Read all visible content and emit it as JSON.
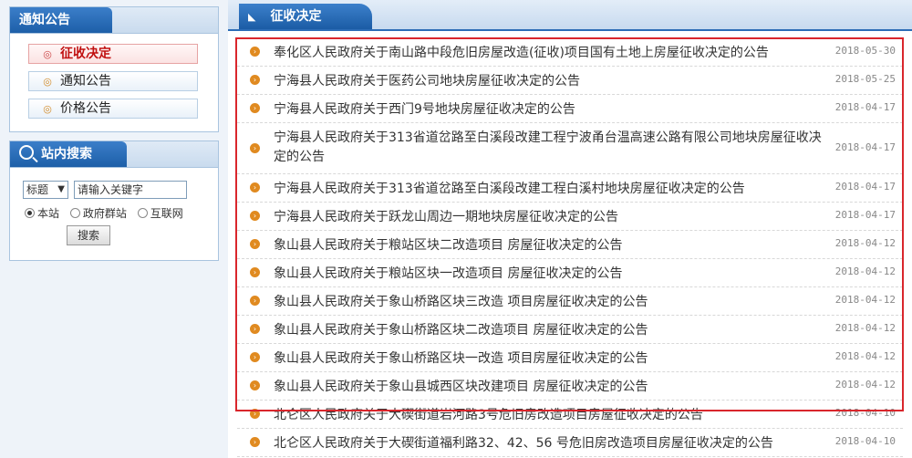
{
  "sidebar": {
    "notice_box": {
      "title": "通知公告",
      "items": [
        {
          "label": "征收决定",
          "active": true
        },
        {
          "label": "通知公告",
          "active": false
        },
        {
          "label": "价格公告",
          "active": false
        }
      ]
    },
    "search_box": {
      "title": "站内搜索",
      "field_select": "标题",
      "keyword_placeholder": "请输入关键字",
      "scopes": [
        {
          "label": "本站",
          "selected": true
        },
        {
          "label": "政府群站",
          "selected": false
        },
        {
          "label": "互联网",
          "selected": false
        }
      ],
      "search_button": "搜索"
    }
  },
  "main": {
    "section_title": "征收决定",
    "items": [
      {
        "title": "奉化区人民政府关于南山路中段危旧房屋改造(征收)项目国有土地上房屋征收决定的公告",
        "date": "2018-05-30"
      },
      {
        "title": "宁海县人民政府关于医药公司地块房屋征收决定的公告",
        "date": "2018-05-25"
      },
      {
        "title": "宁海县人民政府关于西门9号地块房屋征收决定的公告",
        "date": "2018-04-17"
      },
      {
        "title": "宁海县人民政府关于313省道岔路至白溪段改建工程宁波甬台温高速公路有限公司地块房屋征收决定的公告",
        "date": "2018-04-17"
      },
      {
        "title": "宁海县人民政府关于313省道岔路至白溪段改建工程白溪村地块房屋征收决定的公告",
        "date": "2018-04-17"
      },
      {
        "title": "宁海县人民政府关于跃龙山周边一期地块房屋征收决定的公告",
        "date": "2018-04-17"
      },
      {
        "title": "象山县人民政府关于粮站区块二改造项目 房屋征收决定的公告",
        "date": "2018-04-12"
      },
      {
        "title": "象山县人民政府关于粮站区块一改造项目 房屋征收决定的公告",
        "date": "2018-04-12"
      },
      {
        "title": "象山县人民政府关于象山桥路区块三改造 项目房屋征收决定的公告",
        "date": "2018-04-12"
      },
      {
        "title": "象山县人民政府关于象山桥路区块二改造项目 房屋征收决定的公告",
        "date": "2018-04-12"
      },
      {
        "title": "象山县人民政府关于象山桥路区块一改造 项目房屋征收决定的公告",
        "date": "2018-04-12"
      },
      {
        "title": "象山县人民政府关于象山县城西区块改建项目 房屋征收决定的公告",
        "date": "2018-04-12"
      },
      {
        "title": "北仑区人民政府关于大碶街道岩河路3号危旧房改造项目房屋征收决定的公告",
        "date": "2018-04-10"
      },
      {
        "title": "北仑区人民政府关于大碶街道福利路32、42、56 号危旧房改造项目房屋征收决定的公告",
        "date": "2018-04-10"
      }
    ]
  },
  "colors": {
    "tab_blue": "#1d5fa8",
    "highlight_red": "#d9262c",
    "bullet_orange": "#e08a20"
  }
}
